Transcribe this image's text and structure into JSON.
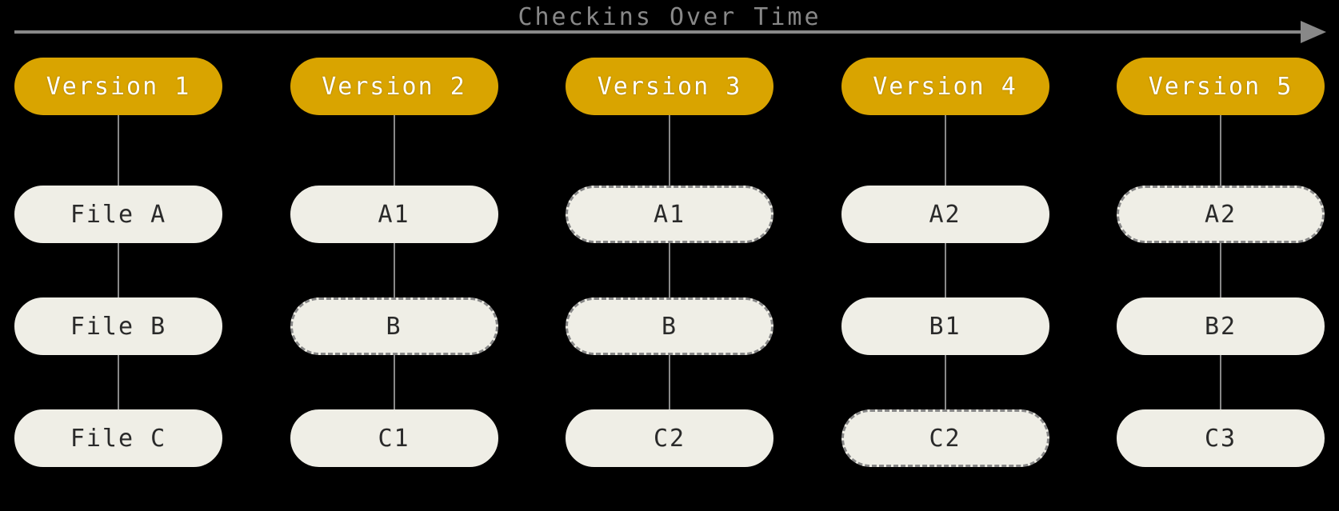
{
  "title": "Checkins Over Time",
  "colors": {
    "accent": "#d9a400",
    "node_bg": "#efeee6",
    "line": "#888888"
  },
  "columns": [
    {
      "version_label": "Version 1",
      "files": [
        {
          "label": "File A",
          "dashed": false
        },
        {
          "label": "File B",
          "dashed": false
        },
        {
          "label": "File C",
          "dashed": false
        }
      ]
    },
    {
      "version_label": "Version 2",
      "files": [
        {
          "label": "A1",
          "dashed": false
        },
        {
          "label": "B",
          "dashed": true
        },
        {
          "label": "C1",
          "dashed": false
        }
      ]
    },
    {
      "version_label": "Version 3",
      "files": [
        {
          "label": "A1",
          "dashed": true
        },
        {
          "label": "B",
          "dashed": true
        },
        {
          "label": "C2",
          "dashed": false
        }
      ]
    },
    {
      "version_label": "Version 4",
      "files": [
        {
          "label": "A2",
          "dashed": false
        },
        {
          "label": "B1",
          "dashed": false
        },
        {
          "label": "C2",
          "dashed": true
        }
      ]
    },
    {
      "version_label": "Version 5",
      "files": [
        {
          "label": "A2",
          "dashed": true
        },
        {
          "label": "B2",
          "dashed": false
        },
        {
          "label": "C3",
          "dashed": false
        }
      ]
    }
  ]
}
